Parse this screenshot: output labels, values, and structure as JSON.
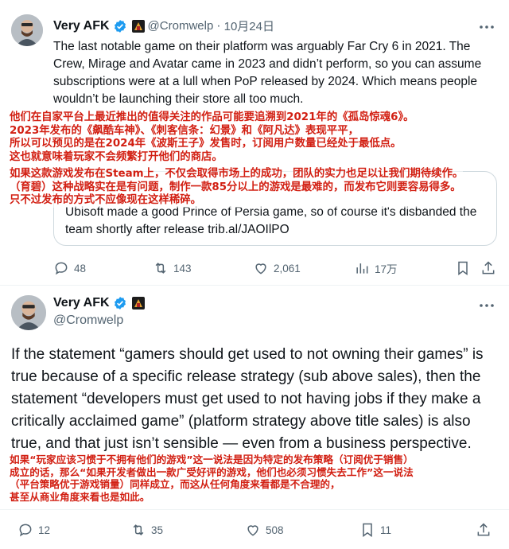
{
  "tweet1": {
    "author_name": "Very AFK",
    "handle": "@Cromwelp",
    "separator": "·",
    "date": "10月24日",
    "text": "The last notable game on their platform was arguably Far Cry 6 in 2021. The Crew, Mirage and Avatar came in 2023 and didn’t perform, so you can assume subscriptions were at a lull when PoP released by 2024. Which means people wouldn’t be launching their store all too much.",
    "translation_overlay_1": [
      "他们在自家平台上最近推出的值得关注的作品可能要追溯到2021年的《孤岛惊魂6》。",
      "2023年发布的《飙酷车神》、《刺客信条：幻景》和《阿凡达》表现平平，",
      "所以可以预见的是在2024年《波斯王子》发售时，订阅用户数量已经处于最低点。",
      "这也就意味着玩家不会频繁打开他们的商店。"
    ],
    "translation_overlay_2": [
      "如果这款游戏发布在Steam上，不仅会取得市场上的成功，团队的实力也足以让我们期待续作。",
      "（育碧）这种战略实在是有问题，制作一款85分以上的游戏是最难的，而发布它则要容易得多。",
      "只不过发布的方式不应像现在这样稀碎。"
    ],
    "quoted_card_text": "Ubisoft made a good Prince of Persia game, so of course it's disbanded the team shortly after release trib.al/JAOIlPO",
    "stats": {
      "replies": "48",
      "retweets": "143",
      "likes": "2,061",
      "views": "17万"
    }
  },
  "tweet2": {
    "author_name": "Very AFK",
    "handle": "@Cromwelp",
    "text": "If the statement “gamers should get used to not owning their games” is true because of a specific release strategy (sub above sales), then the statement “developers must get used to not having jobs if they make a critically acclaimed game” (platform strategy above title sales) is also true, and that just isn’t sensible — even from a business perspective.",
    "translation_overlay": [
      "如果“玩家应该习惯于不拥有他们的游戏”这一说法是因为特定的发布策略（订阅优于销售）",
      "成立的话，那么“如果开发者做出一款广受好评的游戏，他们也必须习惯失去工作”这一说法",
      "（平台策略优于游戏销量）同样成立，而这从任何角度来看都是不合理的，",
      "甚至从商业角度来看也是如此。"
    ],
    "stats": {
      "replies": "12",
      "retweets": "35",
      "likes": "508",
      "bookmarks": "11"
    }
  },
  "colors": {
    "overlay_red": "#d21f12",
    "verified_blue": "#1d9bf0",
    "muted": "#536471"
  },
  "icons": [
    "verified-badge-icon",
    "more-icon",
    "reply-icon",
    "retweet-icon",
    "like-icon",
    "views-icon",
    "bookmark-icon",
    "share-icon"
  ]
}
